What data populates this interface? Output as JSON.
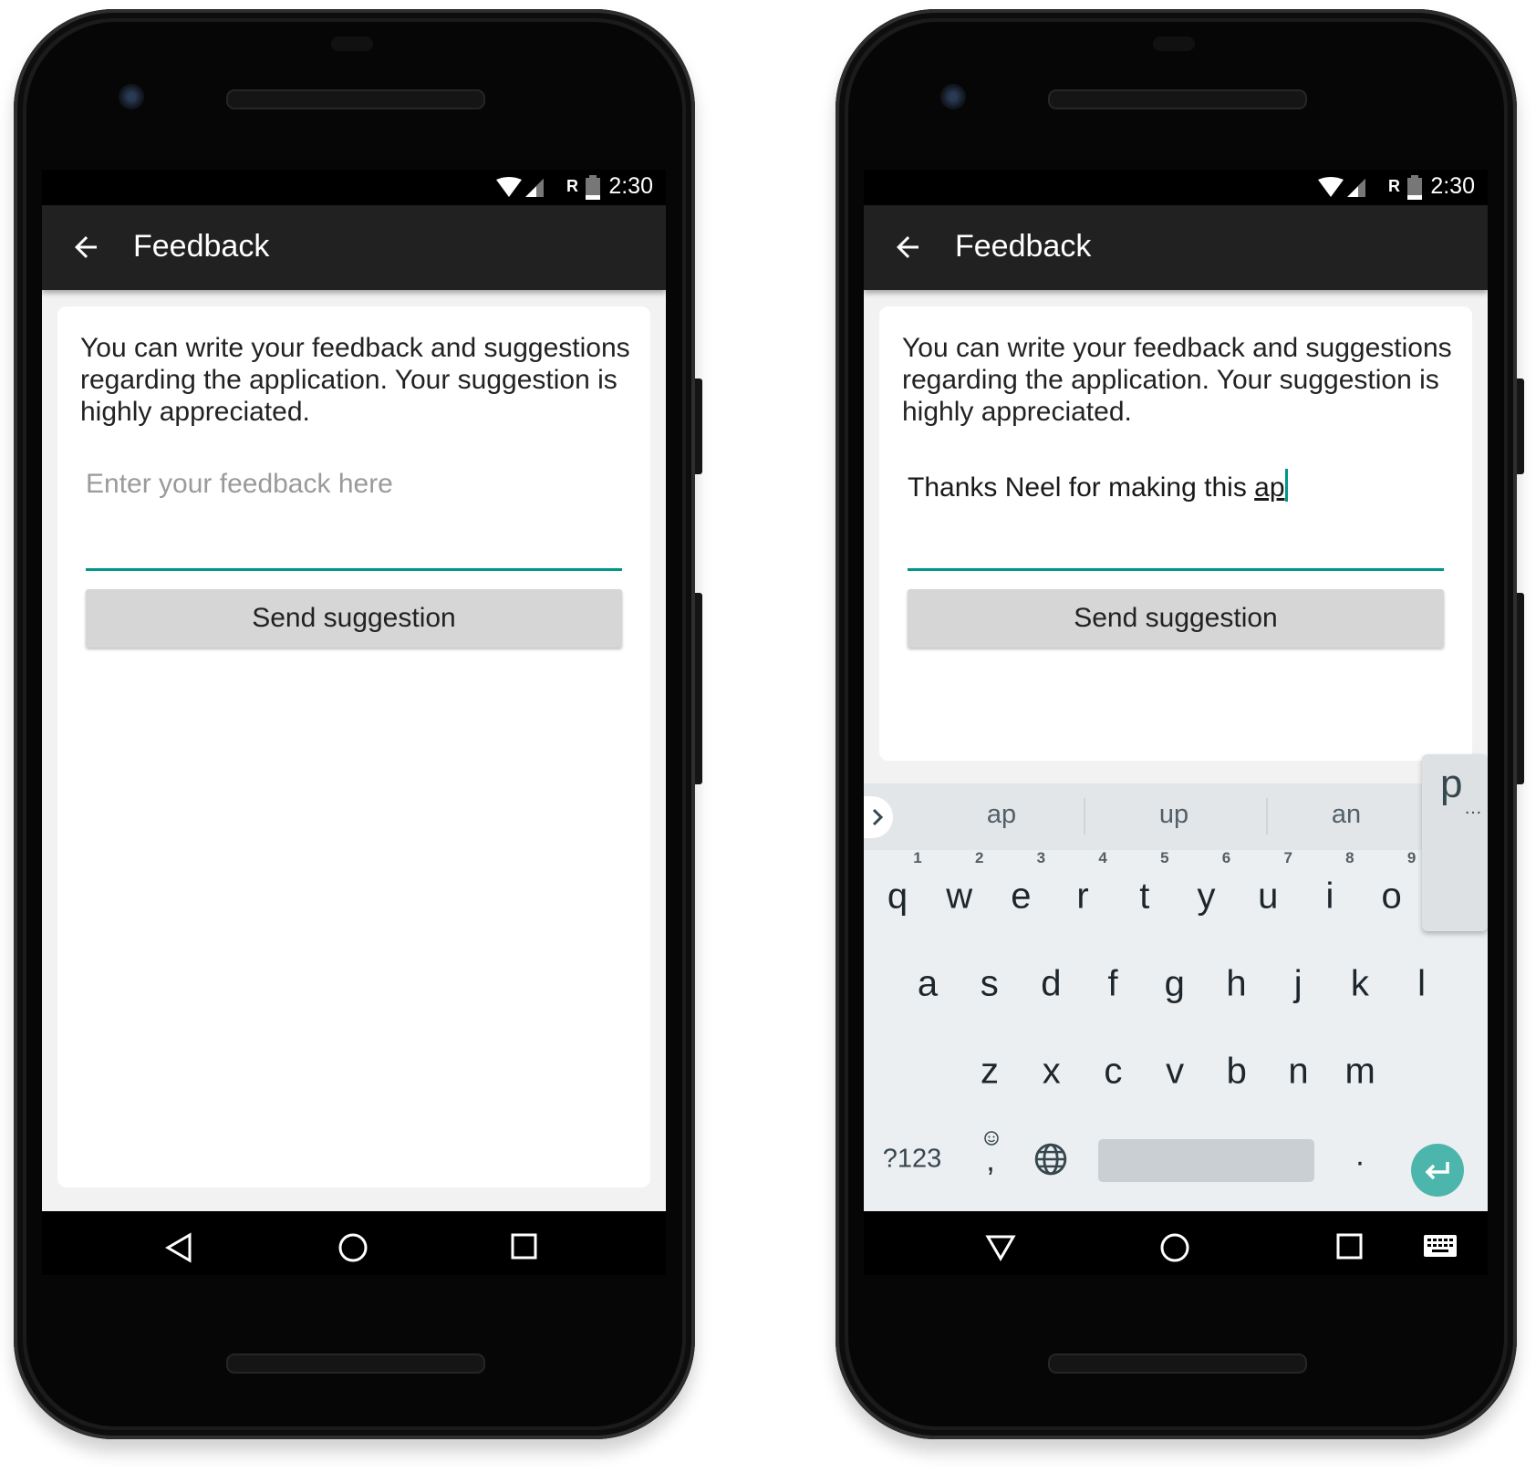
{
  "status_bar": {
    "time": "2:30",
    "roaming": "R",
    "icons": [
      "wifi-icon",
      "signal-icon",
      "battery-icon"
    ]
  },
  "screens": [
    {
      "app_bar": {
        "title": "Feedback",
        "back_icon": "arrow-left-icon"
      },
      "description": "You can write your feedback and suggestions regarding the application. Your suggestion is highly appreciated.",
      "feedback_input": {
        "placeholder": "Enter your feedback here",
        "value": ""
      },
      "send_button": "Send suggestion",
      "nav": [
        "back-icon",
        "home-icon",
        "recents-icon"
      ]
    },
    {
      "app_bar": {
        "title": "Feedback",
        "back_icon": "arrow-left-icon"
      },
      "description": "You can write your feedback and suggestions regarding the application. Your suggestion is highly appreciated.",
      "feedback_input": {
        "placeholder": "Enter your feedback here",
        "value_committed": "Thanks Neel for making this ",
        "value_composing": "ap"
      },
      "send_button": "Send suggestion",
      "nav": [
        "hide-keyboard-icon",
        "home-icon",
        "recents-icon",
        "keyboard-switch-icon"
      ]
    }
  ],
  "keyboard": {
    "suggestions": [
      "ap",
      "up",
      "an"
    ],
    "row1": [
      "q",
      "w",
      "e",
      "r",
      "t",
      "y",
      "u",
      "i",
      "o"
    ],
    "row1_hints": [
      "1",
      "2",
      "3",
      "4",
      "5",
      "6",
      "7",
      "8",
      "9"
    ],
    "row2": [
      "a",
      "s",
      "d",
      "f",
      "g",
      "h",
      "j",
      "k",
      "l"
    ],
    "row3": [
      "z",
      "x",
      "c",
      "v",
      "b",
      "n",
      "m"
    ],
    "symbols_key": "?123",
    "comma_key": ",",
    "period_key": ".",
    "popup_key": "p",
    "popup_more": "…"
  },
  "colors": {
    "accent": "#009688",
    "enter_key": "#4db6ac",
    "app_bar": "#212121",
    "button": "#d6d6d6"
  }
}
